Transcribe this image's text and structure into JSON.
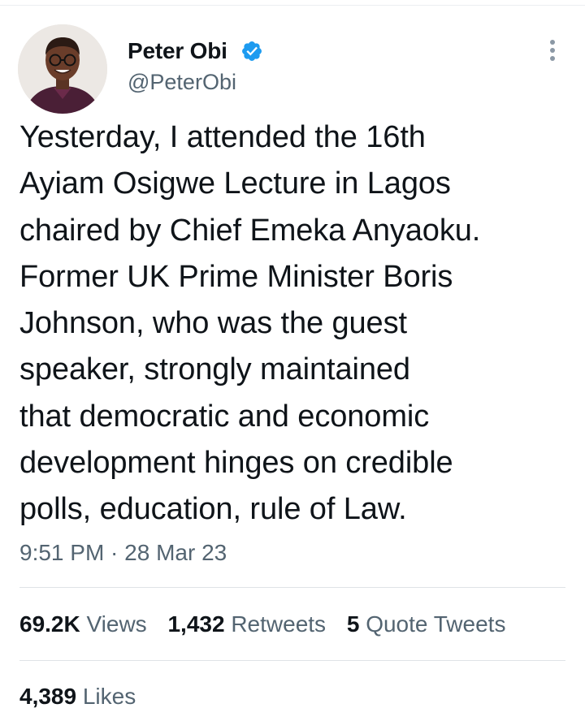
{
  "author": {
    "name": "Peter Obi",
    "handle": "@PeterObi"
  },
  "tweet": {
    "text": "Yesterday, I attended the 16th\nAyiam Osigwe Lecture in Lagos\nchaired by Chief Emeka Anyaoku.\nFormer UK Prime Minister Boris\nJohnson, who was the guest\nspeaker, strongly maintained\nthat democratic and economic\ndevelopment hinges on credible\npolls, education, rule of Law.",
    "timestamp": "9:51 PM · 28 Mar 23"
  },
  "stats": {
    "views_count": "69.2K",
    "views_label": "Views",
    "retweets_count": "1,432",
    "retweets_label": "Retweets",
    "quotes_count": "5",
    "quotes_label": "Quote Tweets",
    "likes_count": "4,389",
    "likes_label": "Likes"
  },
  "icons": {
    "verified": "verified-badge-icon",
    "more": "more-options-icon"
  },
  "colors": {
    "text_primary": "#0f1419",
    "text_secondary": "#536471",
    "verified_blue": "#1d9bf0",
    "divider": "#dfe3e6"
  }
}
